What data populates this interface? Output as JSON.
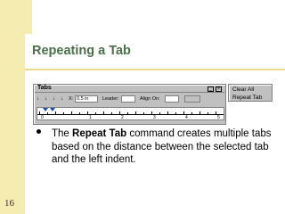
{
  "slide": {
    "title": "Repeating a Tab",
    "page_number": "16",
    "accent_color": "#f4ecb0",
    "title_color": "#4a6f4a"
  },
  "tabs_window": {
    "title": "Tabs",
    "x_label": "X:",
    "x_value": "0.5 in",
    "leader_label": "Leader:",
    "align_on_label": "Align On:",
    "ruler_numbers": [
      "0",
      "1",
      "2",
      "3",
      "4",
      "5"
    ]
  },
  "context_menu": {
    "items": [
      "Clear All",
      "Repeat Tab"
    ]
  },
  "body": {
    "prefix": "The ",
    "bold": "Repeat Tab",
    "suffix": " command creates multiple tabs based on the distance between the selected tab and the left indent."
  }
}
